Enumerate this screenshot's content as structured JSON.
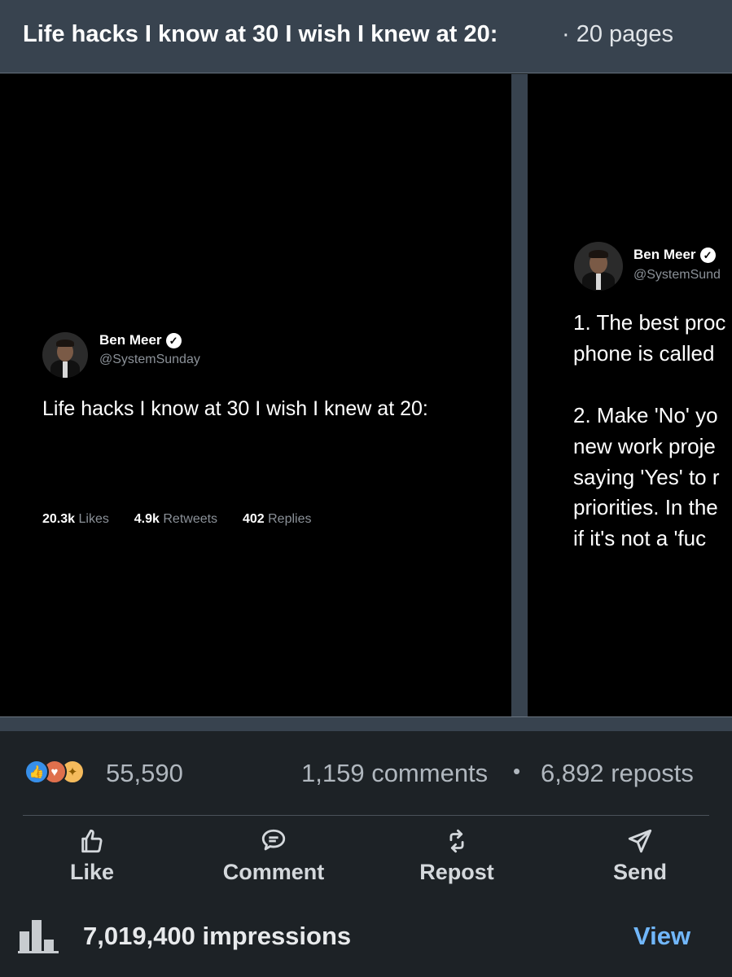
{
  "header": {
    "title": "Life hacks I know at 30 I wish I knew at 20:",
    "pages": "· 20 pages"
  },
  "slide1": {
    "name": "Ben Meer",
    "handle": "@SystemSunday",
    "text": "Life hacks I know at 30 I wish I knew at 20:",
    "likes_value": "20.3k",
    "likes_label": "Likes",
    "retweets_value": "4.9k",
    "retweets_label": "Retweets",
    "replies_value": "402",
    "replies_label": "Replies"
  },
  "slide2": {
    "name": "Ben Meer",
    "handle": "@SystemSund",
    "lines": [
      "1. The best proc",
      "phone is called",
      "",
      "2. Make 'No' yo",
      "new work proje",
      "saying 'Yes' to r",
      "priorities. In the",
      "if it's not a 'fuc"
    ]
  },
  "social": {
    "reaction_count": "55,590",
    "comments": "1,159 comments",
    "separator": "•",
    "reposts": "6,892 reposts",
    "reaction_icons": [
      "like-reaction-icon",
      "love-reaction-icon",
      "insightful-reaction-icon"
    ]
  },
  "actions": {
    "like": "Like",
    "comment": "Comment",
    "repost": "Repost",
    "send": "Send"
  },
  "impressions": {
    "text": "7,019,400 impressions",
    "view": "View"
  },
  "colors": {
    "header_bg": "#38434f",
    "page_bg": "#1d2226",
    "link": "#71b7fb",
    "like_reaction": "#378fe9",
    "love_reaction": "#df704d",
    "insight_reaction": "#f5bb5c"
  }
}
